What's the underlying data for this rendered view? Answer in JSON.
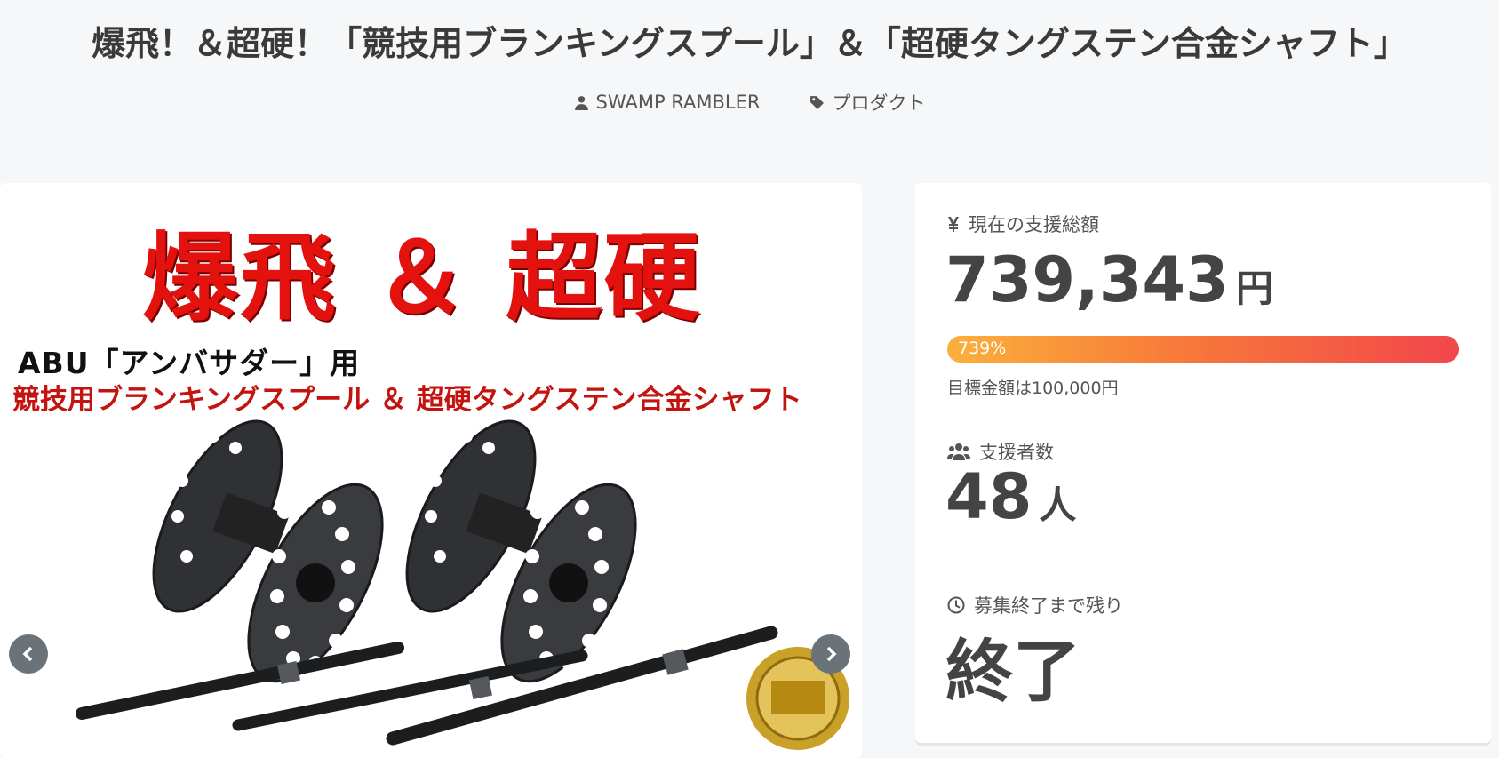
{
  "page": {
    "title": "爆飛！＆超硬！「競技用ブランキングスプール」＆「超硬タングステン合金シャフト」",
    "author": "SWAMP RAMBLER",
    "category": "プロダクト"
  },
  "gallery": {
    "banner_main": "爆飛 ＆ 超硬",
    "banner_line1": "ABU「アンバサダー」用",
    "banner_line2": "競技用ブランキングスプール ＆ 超硬タングステン合金シャフト",
    "prev_icon": "chevron-left-icon",
    "next_icon": "chevron-right-icon"
  },
  "stats": {
    "total_label": "現在の支援総額",
    "total_amount": "739,343",
    "total_unit": "円",
    "progress_text": "739%",
    "progress_percent": 739,
    "goal_text": "目標金額は100,000円",
    "supporters_label": "支援者数",
    "supporters_count": "48",
    "supporters_unit": "人",
    "remaining_label": "募集終了まで残り",
    "remaining_value": "終了"
  },
  "colors": {
    "background": "#f6f7f8",
    "progress_start": "#fbb03b",
    "progress_end": "#f2464b",
    "banner_red": "#e4120e"
  }
}
